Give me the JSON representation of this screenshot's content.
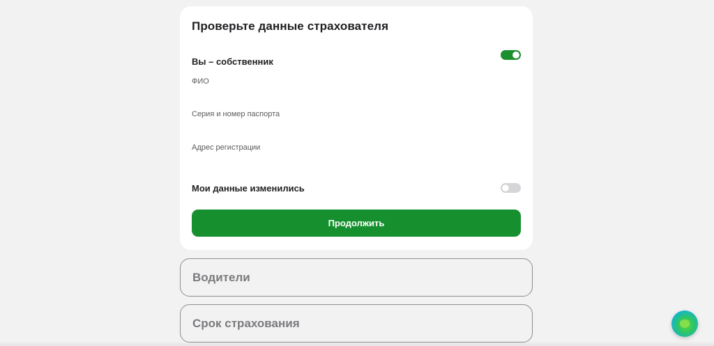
{
  "insurer_card": {
    "title": "Проверьте данные страхователя",
    "owner_toggle": {
      "label": "Вы – собственник",
      "checked": true
    },
    "fields": [
      {
        "label": "ФИО",
        "value": ""
      },
      {
        "label": "Серия и номер паспорта",
        "value": ""
      },
      {
        "label": "Адрес регистрации",
        "value": ""
      }
    ],
    "changed_toggle": {
      "label": "Мои данные изменились",
      "checked": false
    },
    "continue_label": "Продолжить"
  },
  "sections": [
    {
      "title": "Водители"
    },
    {
      "title": "Срок страхования"
    }
  ],
  "colors": {
    "accent": "#16902e",
    "background": "#f2f2f2",
    "card": "#ffffff",
    "toggle_off": "#d6d6d8"
  },
  "icons": {
    "assistant": "assistant-orb-icon"
  }
}
